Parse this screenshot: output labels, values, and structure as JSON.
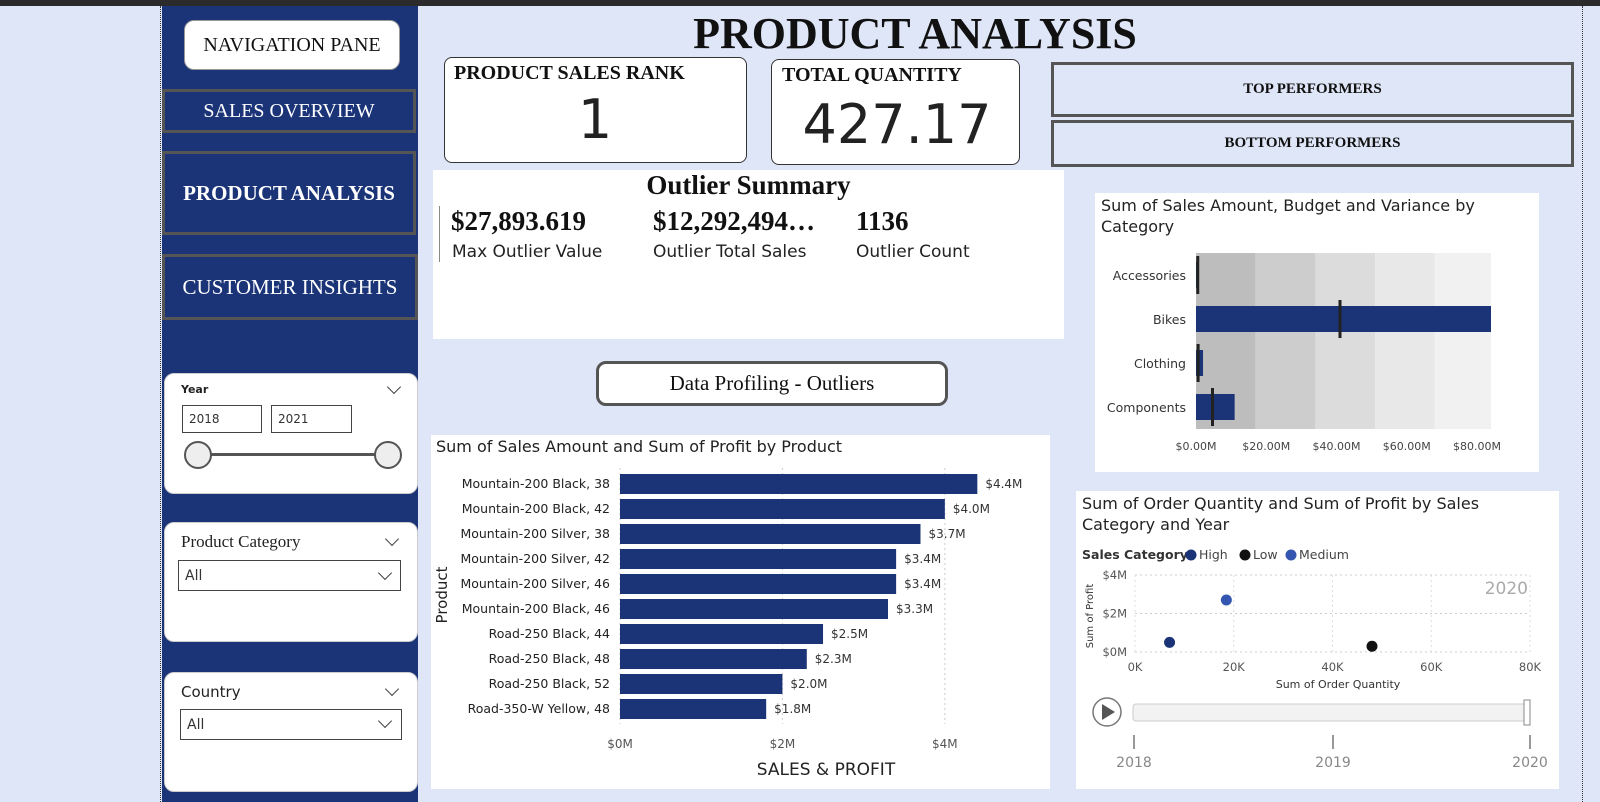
{
  "page_title": "PRODUCT ANALYSIS",
  "nav": {
    "pane_label": "NAVIGATION PANE",
    "items": [
      {
        "label": "SALES OVERVIEW"
      },
      {
        "label": "PRODUCT ANALYSIS"
      },
      {
        "label": "CUSTOMER INSIGHTS"
      }
    ]
  },
  "filters": {
    "year": {
      "label": "Year",
      "from": "2018",
      "to": "2021"
    },
    "category": {
      "label": "Product Category",
      "value": "All"
    },
    "country": {
      "label": "Country",
      "value": "All"
    }
  },
  "kpis": {
    "rank": {
      "title": "PRODUCT SALES RANK",
      "value": "1"
    },
    "quantity": {
      "title": "TOTAL QUANTITY",
      "value": "427.17"
    }
  },
  "performers": {
    "top": "TOP PERFORMERS",
    "bottom": "BOTTOM PERFORMERS"
  },
  "outlier": {
    "title": "Outlier Summary",
    "items": [
      {
        "value": "$27,893.619",
        "label": "Max Outlier Value"
      },
      {
        "value": "$12,292,494…",
        "label": "Outlier Total Sales"
      },
      {
        "value": "1136",
        "label": "Outlier Count"
      }
    ]
  },
  "profiling_button": "Data Profiling - Outliers",
  "colors": {
    "accent": "#1b3478",
    "panel_bg": "#dfe6f8",
    "medium": "#3456b0",
    "low": "#111111"
  },
  "chart_data": [
    {
      "type": "bar",
      "title": "Sum of Sales Amount and Sum of Profit by Product",
      "ylabel": "Product",
      "xlabel": "SALES & PROFIT",
      "categories": [
        "Mountain-200 Black, 38",
        "Mountain-200 Black, 42",
        "Mountain-200 Silver, 38",
        "Mountain-200 Silver, 42",
        "Mountain-200 Silver, 46",
        "Mountain-200 Black, 46",
        "Road-250 Black, 44",
        "Road-250 Black, 48",
        "Road-250 Black, 52",
        "Road-350-W Yellow, 48"
      ],
      "values": [
        4.4,
        4.0,
        3.7,
        3.4,
        3.4,
        3.3,
        2.5,
        2.3,
        2.0,
        1.8
      ],
      "data_labels": [
        "$4.4M",
        "$4.0M",
        "$3.7M",
        "$3.4M",
        "$3.4M",
        "$3.3M",
        "$2.5M",
        "$2.3M",
        "$2.0M",
        "$1.8M"
      ],
      "xticks": [
        "$0M",
        "$2M",
        "$4M"
      ],
      "xlim": [
        0,
        4.95
      ]
    },
    {
      "type": "bar",
      "title": "Sum of Sales Amount, Budget and Variance by Category",
      "categories": [
        "Accessories",
        "Bikes",
        "Clothing",
        "Components"
      ],
      "values": [
        0.7,
        84.0,
        2.0,
        11.0
      ],
      "budget": [
        0.5,
        41.0,
        0.6,
        4.7
      ],
      "bands": [
        17,
        34,
        51,
        68,
        84
      ],
      "xticks": [
        "$0.00M",
        "$20.00M",
        "$40.00M",
        "$60.00M",
        "$80.00M"
      ],
      "xlim": [
        0,
        84
      ]
    },
    {
      "type": "scatter",
      "title": "Sum of Order Quantity and Sum of Profit by Sales Category and Year",
      "legend_title": "Sales Category",
      "series": [
        {
          "name": "High",
          "color": "#1b3478",
          "points": [
            [
              7000,
              0.5
            ]
          ]
        },
        {
          "name": "Low",
          "color": "#111111",
          "points": [
            [
              48000,
              0.3
            ]
          ]
        },
        {
          "name": "Medium",
          "color": "#3456b0",
          "points": [
            [
              18500,
              2.7
            ]
          ]
        }
      ],
      "xlabel": "Sum of Order Quantity",
      "ylabel": "Sum of Profit",
      "xticks": [
        "0K",
        "20K",
        "40K",
        "60K",
        "80K"
      ],
      "yticks": [
        "$0M",
        "$2M",
        "$4M"
      ],
      "xlim": [
        0,
        80000
      ],
      "ylim": [
        0,
        4
      ],
      "year_watermark": "2020",
      "play_axis": [
        "2018",
        "2019",
        "2020"
      ]
    }
  ]
}
